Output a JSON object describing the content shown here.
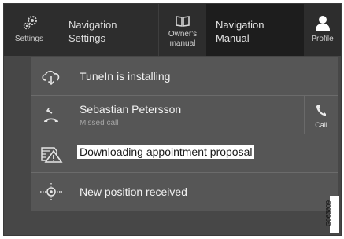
{
  "tabs": {
    "settings": {
      "label": "Settings",
      "icon": "settings-icon"
    },
    "navigation_settings": {
      "label": "Navigation Settings"
    },
    "owners_manual": {
      "label": "Owner's manual",
      "icon": "book-icon"
    },
    "navigation_manual": {
      "label": "Navigation Manual"
    },
    "profile": {
      "label": "Profile",
      "icon": "profile-icon"
    }
  },
  "notifications": [
    {
      "icon": "cloud-download-icon",
      "title": "TuneIn is installing"
    },
    {
      "icon": "missed-call-icon",
      "title": "Sebastian Petersson",
      "subtitle": "Missed call",
      "action_label": "Call",
      "action_icon": "phone-icon"
    },
    {
      "icon": "warning-calendar-icon",
      "title": "Downloading appointment proposal"
    },
    {
      "icon": "position-icon",
      "title": "New position received"
    }
  ],
  "figure_id": "G063809",
  "colors": {
    "topbar": "#2d2d2d",
    "active_tab": "#1d1d1d",
    "panel": "#474747",
    "row": "#565656",
    "text": "#f2f2f2"
  }
}
